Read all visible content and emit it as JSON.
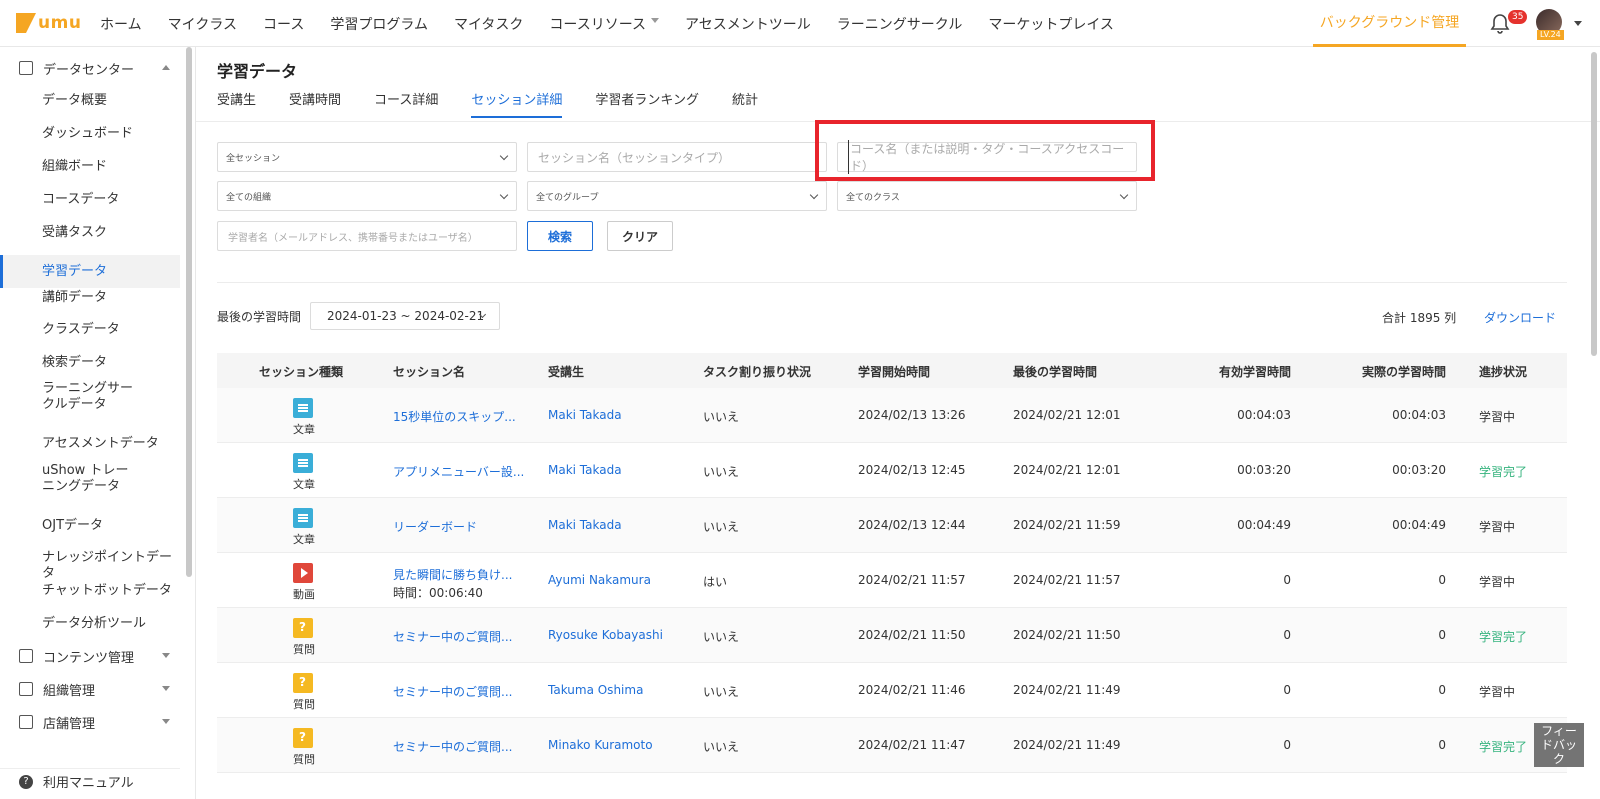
{
  "app": {
    "logo": "umu"
  },
  "topnav": {
    "items": [
      "ホーム",
      "マイクラス",
      "コース",
      "学習プログラム",
      "マイタスク",
      "コースリソース",
      "アセスメントツール",
      "ラーニングサークル",
      "マーケットプレイス"
    ],
    "background_manage": "バックグラウンド管理",
    "notification_count": "35",
    "user_level": "LV.24"
  },
  "sidebar": {
    "data_center": "データセンター",
    "items": [
      "データ概要",
      "ダッシュボード",
      "組織ボード",
      "コースデータ",
      "受講タスク",
      "学習データ",
      "講師データ",
      "クラスデータ",
      "検索データ",
      "ラーニングサークルデータ",
      "アセスメントデータ",
      "uShow トレーニングデータ",
      "OJTデータ",
      "ナレッジポイントデータ",
      "チャットボットデータ",
      "データ分析ツール"
    ],
    "active_index": 5,
    "content_manage": "コンテンツ管理",
    "org_manage": "組織管理",
    "store_manage": "店舗管理",
    "manual": "利用マニュアル"
  },
  "page": {
    "title": "学習データ",
    "tabs": [
      "受講生",
      "受講時間",
      "コース詳細",
      "セッション詳細",
      "学習者ランキング",
      "統計"
    ],
    "active_tab": 3
  },
  "filters": {
    "session_select": "全セッション",
    "session_name_placeholder": "セッション名（セッションタイプ）",
    "course_name_placeholder": "コース名（または説明・タグ・コースアクセスコード）",
    "org_select": "全ての組織",
    "group_select": "全てのグループ",
    "class_select": "全てのクラス",
    "learner_placeholder": "学習者名（メールアドレス、携帯番号またはユーザ名）",
    "search_button": "検索",
    "clear_button": "クリア"
  },
  "summary": {
    "date_label": "最後の学習時間",
    "date_range": "2024-01-23 ~ 2024-02-21",
    "total": "合計 1895 列",
    "download": "ダウンロード"
  },
  "table": {
    "headers": [
      "セッション種類",
      "セッション名",
      "受講生",
      "タスク割り振り状況",
      "学習開始時間",
      "最後の学習時間",
      "有効学習時間",
      "実際の学習時間",
      "進捗状況"
    ],
    "rows": [
      {
        "type": "doc",
        "type_label": "文章",
        "name": "15秒単位のスキップ...",
        "sub": "",
        "learner": "Maki Takada",
        "assigned": "いいえ",
        "start": "2024/02/13 13:26",
        "last": "2024/02/21 12:01",
        "effective": "00:04:03",
        "actual": "00:04:03",
        "status": "学習中",
        "done": false
      },
      {
        "type": "doc",
        "type_label": "文章",
        "name": "アプリメニューバー設...",
        "sub": "",
        "learner": "Maki Takada",
        "assigned": "いいえ",
        "start": "2024/02/13 12:45",
        "last": "2024/02/21 12:01",
        "effective": "00:03:20",
        "actual": "00:03:20",
        "status": "学習完了",
        "done": true
      },
      {
        "type": "doc",
        "type_label": "文章",
        "name": "リーダーボード",
        "sub": "",
        "learner": "Maki Takada",
        "assigned": "いいえ",
        "start": "2024/02/13 12:44",
        "last": "2024/02/21 11:59",
        "effective": "00:04:49",
        "actual": "00:04:49",
        "status": "学習中",
        "done": false
      },
      {
        "type": "video",
        "type_label": "動画",
        "name": "見た瞬間に勝ち負け...",
        "sub": "時間：00:06:40",
        "learner": "Ayumi Nakamura",
        "assigned": "はい",
        "start": "2024/02/21 11:57",
        "last": "2024/02/21 11:57",
        "effective": "0",
        "actual": "0",
        "status": "学習中",
        "done": false
      },
      {
        "type": "quiz",
        "type_label": "質問",
        "name": "セミナー中のご質問...",
        "sub": "",
        "learner": "Ryosuke Kobayashi",
        "assigned": "いいえ",
        "start": "2024/02/21 11:50",
        "last": "2024/02/21 11:50",
        "effective": "0",
        "actual": "0",
        "status": "学習完了",
        "done": true
      },
      {
        "type": "quiz",
        "type_label": "質問",
        "name": "セミナー中のご質問...",
        "sub": "",
        "learner": "Takuma Oshima",
        "assigned": "いいえ",
        "start": "2024/02/21 11:46",
        "last": "2024/02/21 11:49",
        "effective": "0",
        "actual": "0",
        "status": "学習中",
        "done": false
      },
      {
        "type": "quiz",
        "type_label": "質問",
        "name": "セミナー中のご質問...",
        "sub": "",
        "learner": "Minako Kuramoto",
        "assigned": "いいえ",
        "start": "2024/02/21 11:47",
        "last": "2024/02/21 11:49",
        "effective": "0",
        "actual": "0",
        "status": "学習完了",
        "done": true
      }
    ]
  },
  "feedback": "フィードバック"
}
